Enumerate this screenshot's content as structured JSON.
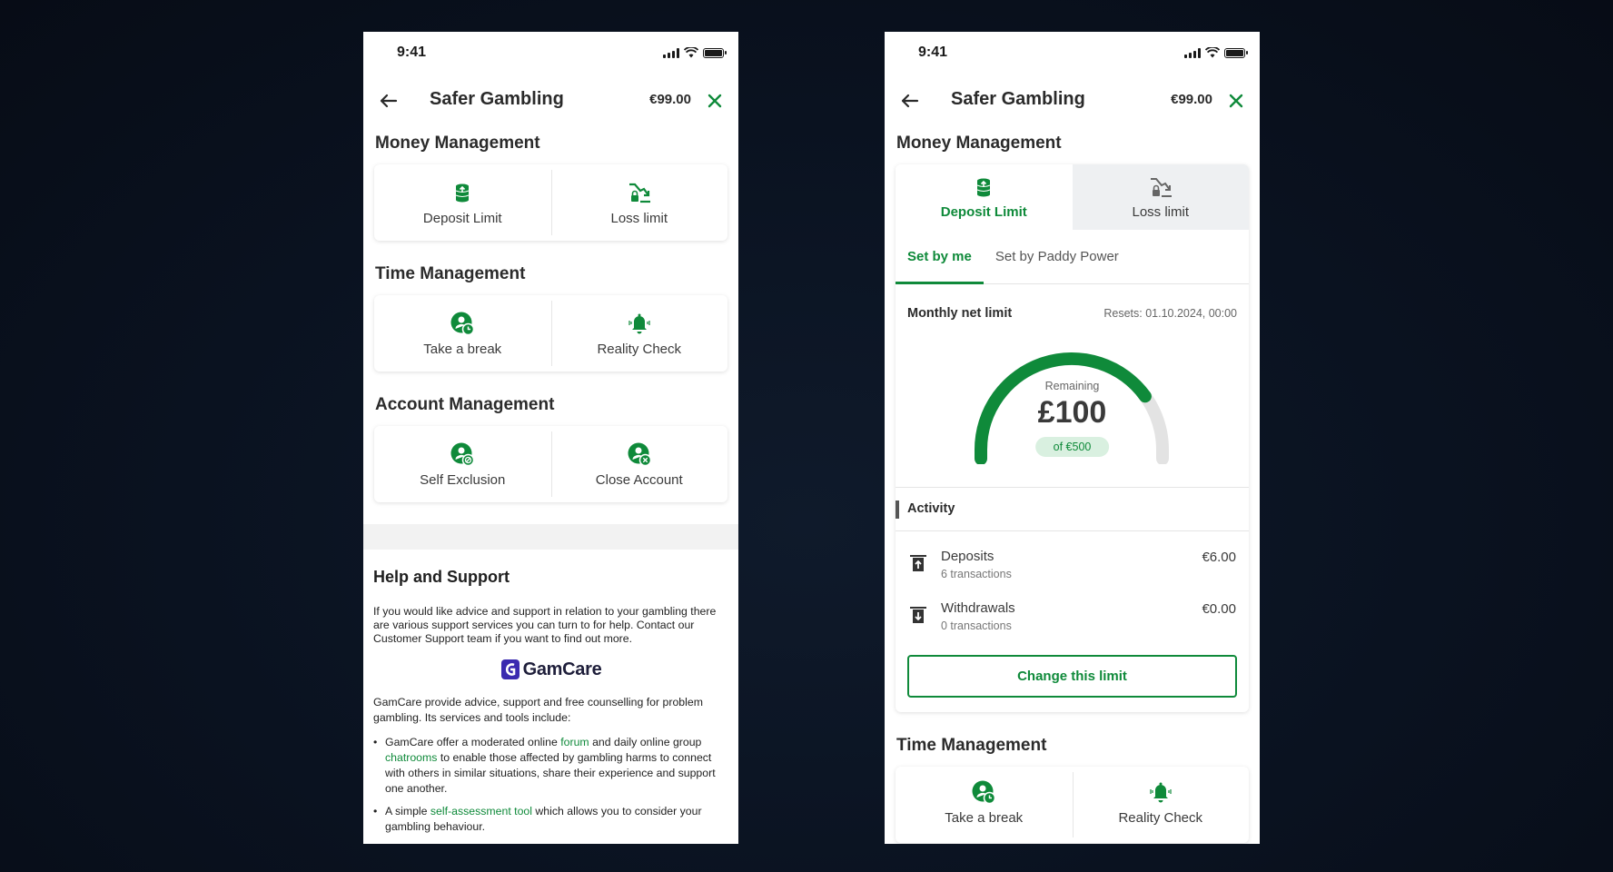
{
  "status": {
    "time": "9:41"
  },
  "header": {
    "title": "Safer Gambling",
    "balance": "€99.00"
  },
  "left": {
    "money": {
      "title": "Money Management",
      "deposit_label": "Deposit Limit",
      "loss_label": "Loss limit"
    },
    "time": {
      "title": "Time Management",
      "break_label": "Take a break",
      "reality_label": "Reality Check"
    },
    "account": {
      "title": "Account Management",
      "exclusion_label": "Self Exclusion",
      "close_label": "Close Account"
    },
    "help": {
      "title": "Help and Support",
      "intro": "If you would like advice and support in relation to your gambling there are various support services you can turn to for help. Contact our Customer Support team if you want to find out more.",
      "logo_text": "GamCare",
      "para": "GamCare provide advice, support and free counselling for problem gambling. Its services and tools include:",
      "bullet1_a": "GamCare offer a moderated online ",
      "bullet1_link1": "forum",
      "bullet1_b": " and daily online group ",
      "bullet1_link2": "chatrooms",
      "bullet1_c": " to enable those affected by gambling harms to connect with others in similar situations, share their experience and support one another.",
      "bullet2_a": "A simple ",
      "bullet2_link": "self-assessment tool",
      "bullet2_b": " which allows you to consider your gambling behaviour."
    }
  },
  "right": {
    "money_title": "Money Management",
    "tabs": {
      "deposit": "Deposit Limit",
      "loss": "Loss limit"
    },
    "subtabs": {
      "set_by_me": "Set by me",
      "set_by_pp": "Set by Paddy Power"
    },
    "limit": {
      "label": "Monthly net limit",
      "reset": "Resets: 01.10.2024, 00:00",
      "remaining_label": "Remaining",
      "remaining_amount": "£100",
      "of_total": "of €500",
      "remaining_fraction": 0.8
    },
    "activity": {
      "title": "Activity",
      "deposits": {
        "name": "Deposits",
        "sub": "6 transactions",
        "amount": "€6.00"
      },
      "withdrawals": {
        "name": "Withdrawals",
        "sub": "0 transactions",
        "amount": "€0.00"
      }
    },
    "change_button": "Change this limit",
    "time_title": "Time Management",
    "time_tabs": {
      "break": "Take a break",
      "reality": "Reality Check"
    }
  },
  "colors": {
    "brand_green": "#0f8a3a",
    "pill_bg": "#d9f0e0",
    "background": "#0a1220"
  }
}
